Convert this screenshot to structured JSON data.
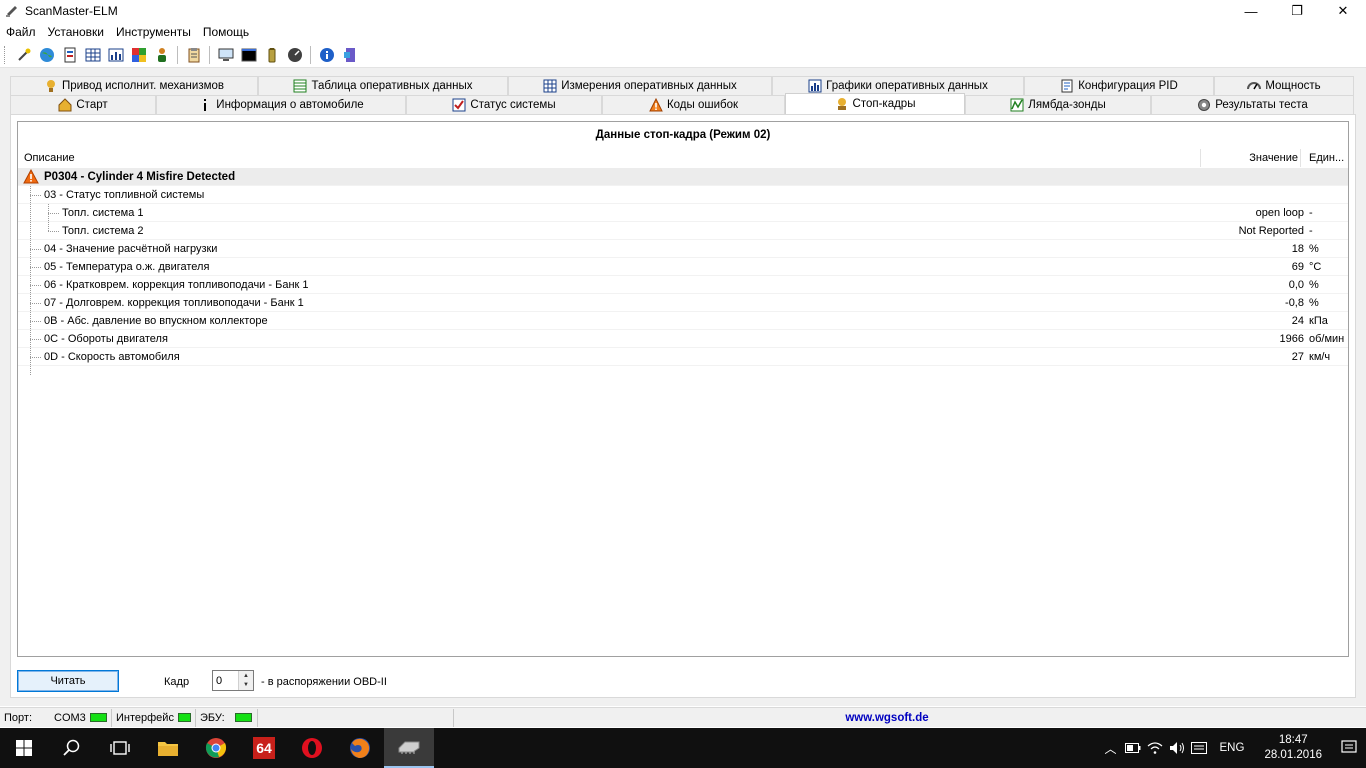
{
  "window": {
    "title": "ScanMaster-ELM",
    "minimize": "—",
    "restore": "❐",
    "close": "✕"
  },
  "menu": [
    "Файл",
    "Установки",
    "Инструменты",
    "Помощь"
  ],
  "tabs_top": [
    {
      "label": "Привод исполнит. механизмов",
      "icon": "actuator-icon"
    },
    {
      "label": "Таблица оперативных данных",
      "icon": "table-icon"
    },
    {
      "label": "Измерения оперативных данных",
      "icon": "grid-icon"
    },
    {
      "label": "Графики оперативных данных",
      "icon": "chart-icon"
    },
    {
      "label": "Конфигурация PID",
      "icon": "config-icon"
    },
    {
      "label": "Мощность",
      "icon": "power-icon"
    }
  ],
  "tabs_bottom": [
    {
      "label": "Старт",
      "icon": "start-icon"
    },
    {
      "label": "Информация о автомобиле",
      "icon": "info-icon"
    },
    {
      "label": "Статус системы",
      "icon": "status-icon"
    },
    {
      "label": "Коды ошибок",
      "icon": "warning-icon"
    },
    {
      "label": "Стоп-кадры",
      "icon": "freeze-frame-icon",
      "active": true
    },
    {
      "label": "Лямбда-зонды",
      "icon": "lambda-icon"
    },
    {
      "label": "Результаты теста",
      "icon": "gear-icon"
    }
  ],
  "grid": {
    "title": "Данные стоп-кадра (Режим 02)",
    "headers": {
      "description": "Описание",
      "value": "Значение",
      "unit": "Един..."
    },
    "dtc": "P0304 - Cylinder 4 Misfire Detected",
    "rows": [
      {
        "desc": "03 - Статус топливной системы",
        "value": "",
        "unit": "",
        "level": 1
      },
      {
        "desc": "Топл. система 1",
        "value": "open loop",
        "unit": "-",
        "level": 2
      },
      {
        "desc": "Топл. система 2",
        "value": "Not Reported",
        "unit": "-",
        "level": 2
      },
      {
        "desc": "04 - Значение расчётной нагрузки",
        "value": "18",
        "unit": "%",
        "level": 1
      },
      {
        "desc": "05 - Температура о.ж. двигателя",
        "value": "69",
        "unit": "°C",
        "level": 1
      },
      {
        "desc": "06 - Кратковрем. коррекция топливоподачи - Банк 1",
        "value": "0,0",
        "unit": "%",
        "level": 1
      },
      {
        "desc": "07 - Долговрем. коррекция топливоподачи - Банк 1",
        "value": "-0,8",
        "unit": "%",
        "level": 1
      },
      {
        "desc": "0B - Абс. давление во впускном коллекторе",
        "value": "24",
        "unit": "кПа",
        "level": 1
      },
      {
        "desc": "0C - Обороты двигателя",
        "value": "1966",
        "unit": "об/мин",
        "level": 1
      },
      {
        "desc": "0D - Скорость автомобиля",
        "value": "27",
        "unit": "км/ч",
        "level": 1
      }
    ]
  },
  "controls": {
    "read_button": "Читать",
    "frame_label": "Кадр",
    "frame_value": "0",
    "frame_suffix": "- в распоряжении OBD-II"
  },
  "status": {
    "port_label": "Порт:",
    "port_value": "COM3",
    "interface_label": "Интерфейс",
    "ecu_label": "ЭБУ:",
    "url": "www.wgsoft.de",
    "led_color": "#14e014"
  },
  "taskbar": {
    "lang": "ENG",
    "time": "18:47",
    "date": "28.01.2016",
    "badge_64": "64"
  }
}
